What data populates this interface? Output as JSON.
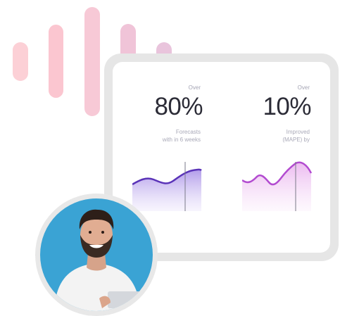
{
  "stats": [
    {
      "over_label": "Over",
      "value": "80%",
      "caption_line1": "Forecasts",
      "caption_line2": "with in 6 weeks"
    },
    {
      "over_label": "Over",
      "value": "10%",
      "caption_line1": "Improved",
      "caption_line2": "(MAPE) by"
    }
  ],
  "colors": {
    "bar_pink": "#fbc6d0",
    "line_purple": "#6a3bc4",
    "line_violet": "#b24bd0",
    "avatar_background": "#3aa3d4"
  }
}
